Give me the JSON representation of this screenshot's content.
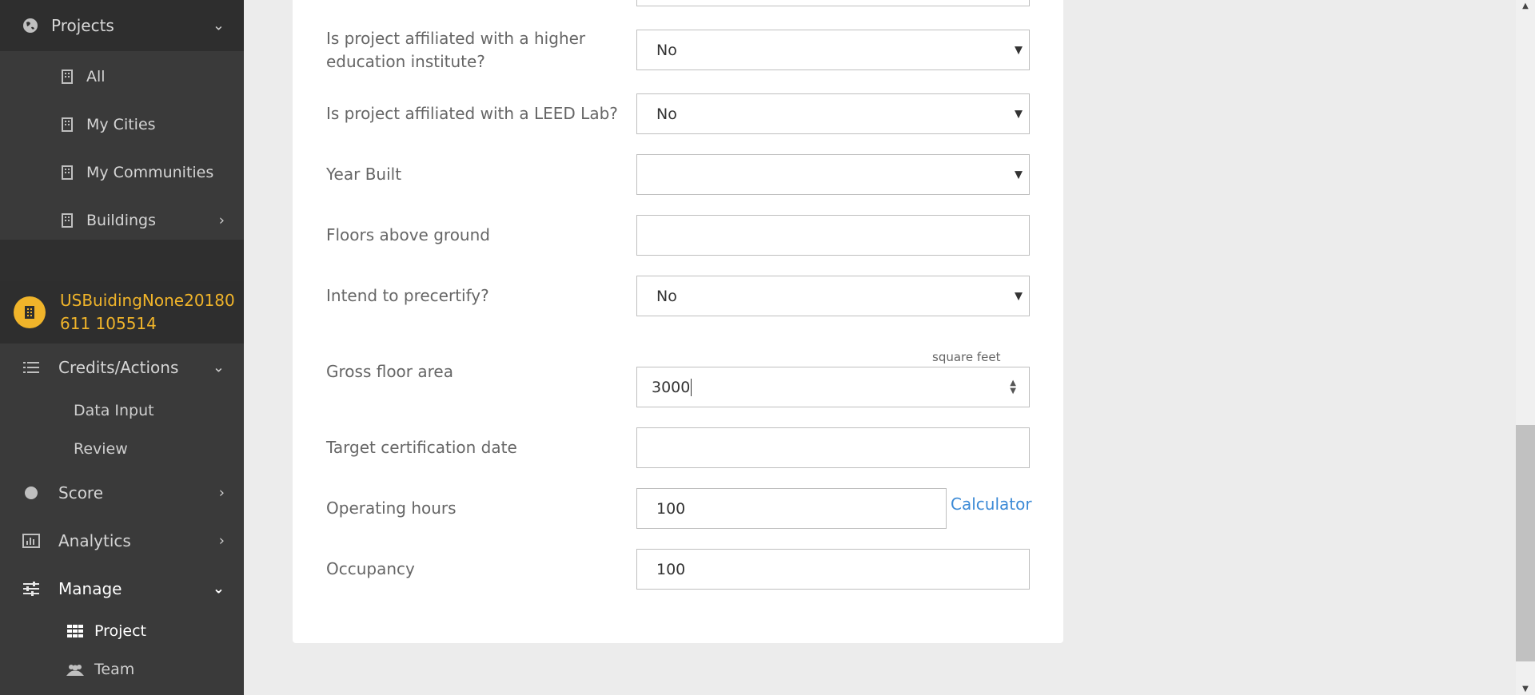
{
  "sidebar": {
    "projects_label": "Projects",
    "sub_items": [
      "All",
      "My Cities",
      "My Communities",
      "Buildings"
    ],
    "project_name": "USBuidingNone20180611 105514",
    "credits_label": "Credits/Actions",
    "credits_children": [
      "Data Input",
      "Review"
    ],
    "score_label": "Score",
    "analytics_label": "Analytics",
    "manage_label": "Manage",
    "manage_children": [
      "Project",
      "Team"
    ]
  },
  "form": {
    "higher_ed": {
      "label": "Is project affiliated with a higher education institute?",
      "value": "No"
    },
    "leed_lab": {
      "label": "Is project affiliated with a LEED Lab?",
      "value": "No"
    },
    "year_built": {
      "label": "Year Built",
      "value": ""
    },
    "floors": {
      "label": "Floors above ground",
      "value": ""
    },
    "precertify": {
      "label": "Intend to precertify?",
      "value": "No"
    },
    "gross_area": {
      "label": "Gross floor area",
      "value": "3000",
      "unit": "square feet"
    },
    "target_date": {
      "label": "Target certification date",
      "value": ""
    },
    "operating_hours": {
      "label": "Operating hours",
      "value": "100",
      "link": "Calculator"
    },
    "occupancy": {
      "label": "Occupancy",
      "value": "100"
    }
  },
  "icons": {
    "globe": "globe-icon",
    "building": "building-icon",
    "list": "list-icon",
    "circle": "circle-icon",
    "chart": "bar-chart-icon",
    "sliders": "sliders-icon",
    "grid": "grid-icon",
    "users": "users-icon"
  },
  "colors": {
    "accent": "#f0b42a",
    "link": "#3c8ad6",
    "sidebar_bg": "#3a3a3a"
  }
}
